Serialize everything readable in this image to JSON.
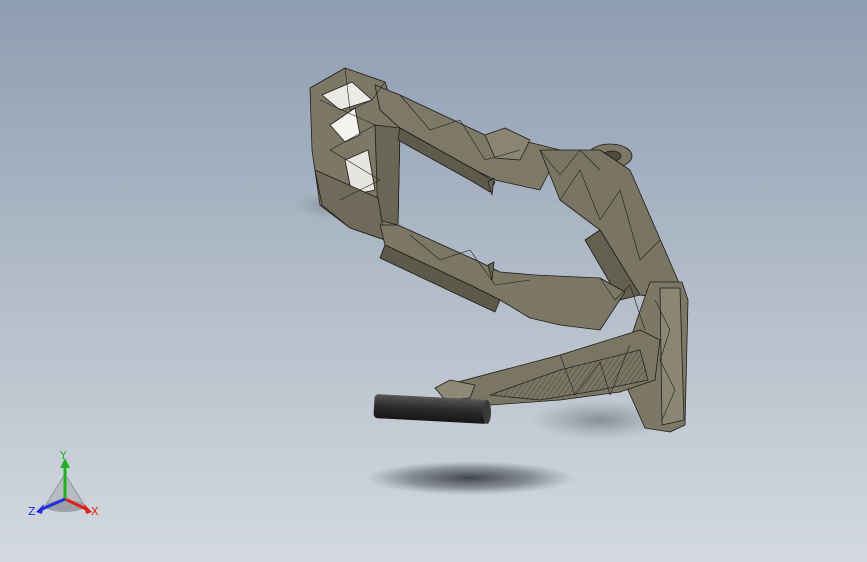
{
  "viewport": {
    "background_top": "#8e9db1",
    "background_bottom": "#d3d9df",
    "model_face_color": "#7a7564",
    "model_edge_color": "#1c1c1a"
  },
  "triad": {
    "x_label": "X",
    "y_label": "Y",
    "z_label": "Z",
    "x_color": "#e02020",
    "y_color": "#20b020",
    "z_color": "#2030e0"
  }
}
